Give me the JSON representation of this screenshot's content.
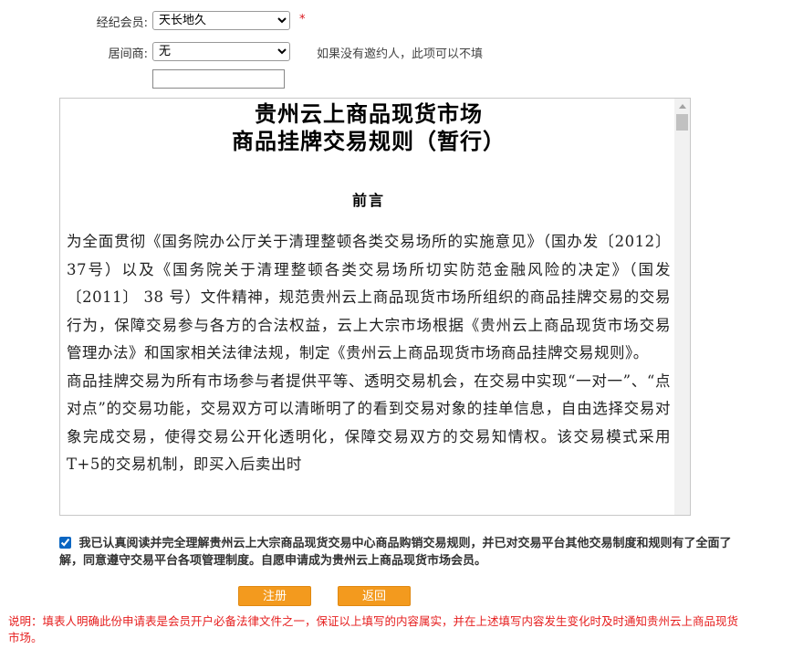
{
  "form": {
    "broker_label": "经纪会员:",
    "broker_value": "天长地久",
    "required_mark": "*",
    "intermediary_label": "居间商:",
    "intermediary_value": "无",
    "intermediary_hint": "如果没有邀约人，此项可以不填",
    "text_value": ""
  },
  "document": {
    "title_line1": "贵州云上商品现货市场",
    "title_line2": "商品挂牌交易规则（暂行）",
    "section": "前言",
    "paragraph1": "为全面贯彻《国务院办公厅关于清理整顿各类交易场所的实施意见》（国办发〔2012〕37号）以及《国务院关于清理整顿各类交易场所切实防范金融风险的决定》（国发〔2011〕 38 号）文件精神，规范贵州云上商品现货市场所组织的商品挂牌交易的交易行为，保障交易参与各方的合法权益，云上大宗市场根据《贵州云上商品现货市场交易管理办法》和国家相关法律法规，制定《贵州云上商品现货市场商品挂牌交易规则》。",
    "paragraph2": "商品挂牌交易为所有市场参与者提供平等、透明交易机会，在交易中实现“一对一”、“点对点”的交易功能，交易双方可以清晰明了的看到交易对象的挂单信息，自由选择交易对象完成交易，使得交易公开化透明化，保障交易双方的交易知情权。该交易模式采用T+5的交易机制，即买入后卖出时"
  },
  "agreement": {
    "checked": true,
    "text": "我已认真阅读并完全理解贵州云上大宗商品现货交易中心商品购销交易规则，并已对交易平台其他交易制度和规则有了全面了解，同意遵守交易平台各项管理制度。自愿申请成为贵州云上商品现货市场会员。"
  },
  "buttons": {
    "register": "注册",
    "back": "返回"
  },
  "note": "说明：填表人明确此份申请表是会员开户必备法律文件之一，保证以上填写的内容属实，并在上述填写内容发生变化时及时通知贵州云上商品现货市场。",
  "colors": {
    "button": "#f39a1e",
    "required": "#d9151b",
    "note": "#e61e1e"
  }
}
